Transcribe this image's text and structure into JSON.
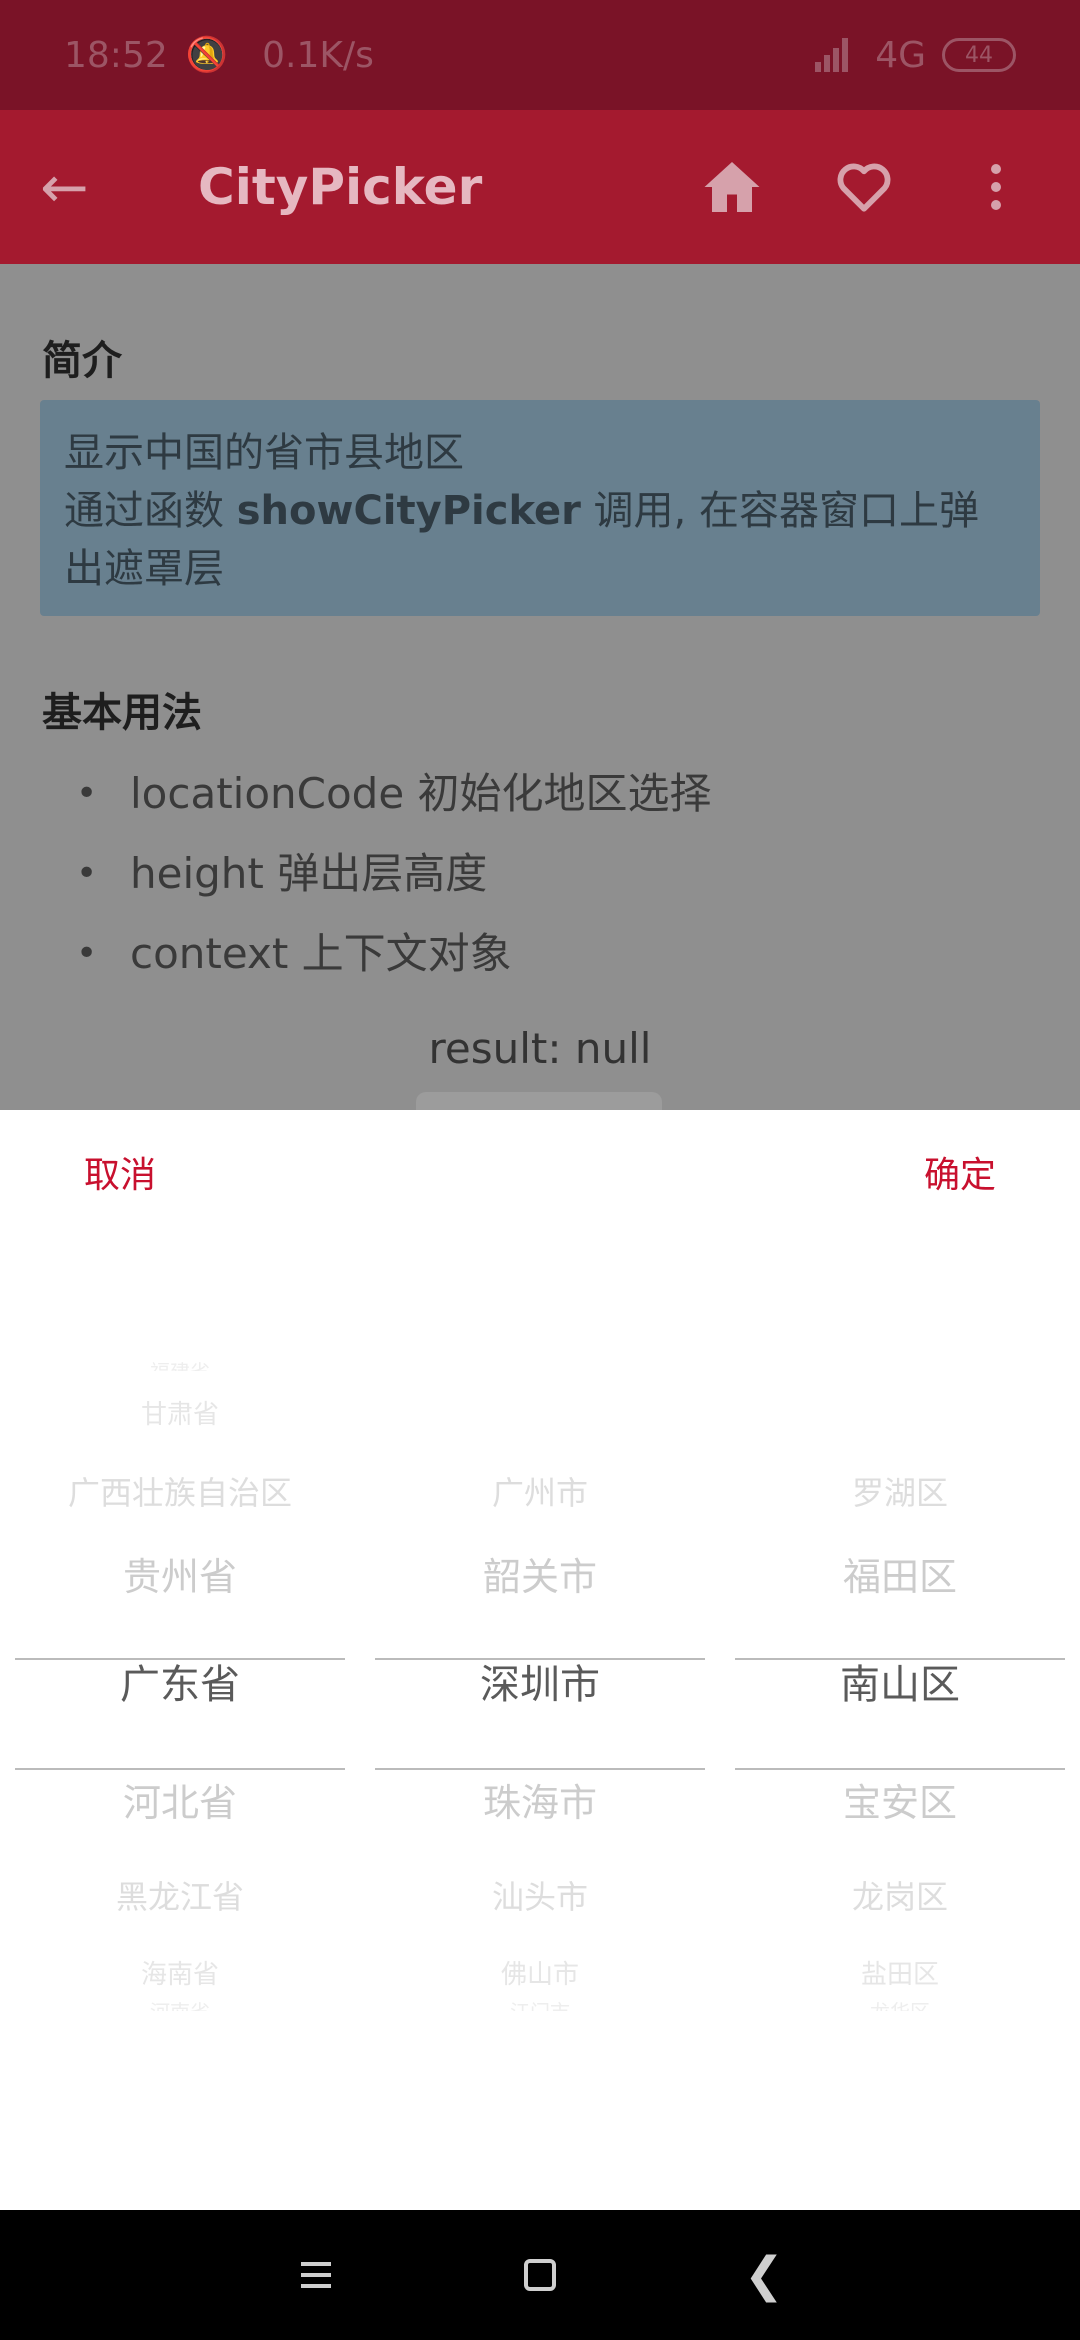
{
  "status": {
    "time": "18:52",
    "speed": "0.1K/s",
    "network": "4G",
    "battery": "44"
  },
  "appbar": {
    "title": "CityPicker"
  },
  "content": {
    "intro_heading": "简介",
    "intro_line1": "显示中国的省市县地区",
    "intro_line2_pre": "通过函数 ",
    "intro_line2_bold": "showCityPicker",
    "intro_line2_post": " 调用, 在容器窗口上弹出遮罩层",
    "usage_heading": "基本用法",
    "bullets": [
      "locationCode 初始化地区选择",
      "height 弹出层高度",
      "context 上下文对象"
    ],
    "result": "result: null"
  },
  "picker": {
    "cancel": "取消",
    "confirm": "确定",
    "provinces": [
      "福建省",
      "甘肃省",
      "广西壮族自治区",
      "贵州省",
      "广东省",
      "河北省",
      "黑龙江省",
      "海南省",
      "河南省"
    ],
    "cities": [
      "",
      "",
      "广州市",
      "韶关市",
      "深圳市",
      "珠海市",
      "汕头市",
      "佛山市",
      "江门市"
    ],
    "districts": [
      "",
      "",
      "罗湖区",
      "福田区",
      "南山区",
      "宝安区",
      "龙岗区",
      "盐田区",
      "龙华区"
    ]
  }
}
